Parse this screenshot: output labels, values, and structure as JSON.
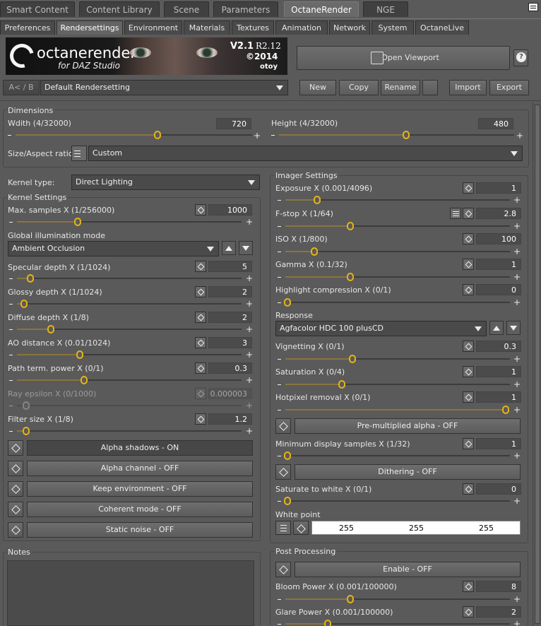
{
  "top_tabs": [
    "Smart Content",
    "Content Library",
    "Scene",
    "Parameters",
    "OctaneRender",
    "NGE"
  ],
  "sub_tabs": [
    "Preferences",
    "Rendersettings",
    "Environment",
    "Materials",
    "Textures",
    "Animation",
    "Network",
    "System",
    "OctaneLive"
  ],
  "logo": {
    "brand": "octanerender",
    "tagline": "for DAZ Studio",
    "version": "V2.1",
    "release": "R2.12",
    "year": "©2014",
    "company": "otoy"
  },
  "toolbar": {
    "ab": "A< / B",
    "preset": "Default Rendersetting",
    "open_viewport": "Open Viewport",
    "help": "?",
    "new": "New",
    "copy": "Copy",
    "rename": "Rename",
    "import": "Import",
    "export": "Export"
  },
  "dimensions": {
    "title": "Dimensions",
    "width_label": "Wdith (4/32000)",
    "width_value": "720",
    "width_pos": 0.6,
    "height_label": "Height (4/32000)",
    "height_value": "480",
    "height_pos": 0.54,
    "aspect_label": "Size/Aspect ratio:",
    "aspect_value": "Custom"
  },
  "kernel": {
    "type_label": "Kernel type:",
    "type_value": "Direct Lighting",
    "settings_title": "Kernel Settings",
    "max_samples": {
      "label": "Max. samples X (1/256000)",
      "value": "1000",
      "pos": 0.27
    },
    "gi_label": "Global illumination mode",
    "gi_value": "Ambient Occlusion",
    "specular": {
      "label": "Specular depth X (1/1024)",
      "value": "5",
      "pos": 0.09
    },
    "glossy": {
      "label": "Glossy depth X (1/1024)",
      "value": "2",
      "pos": 0.06
    },
    "diffuse": {
      "label": "Diffuse depth X (1/8)",
      "value": "2",
      "pos": 0.18
    },
    "ao": {
      "label": "AO distance X (0.01/1024)",
      "value": "3",
      "pos": 0.3
    },
    "path": {
      "label": "Path term. power X (0/1)",
      "value": "0.3",
      "pos": 0.33
    },
    "ray": {
      "label": "Ray epsilon X (0/1000)",
      "value": "0.000003",
      "pos": 0.06
    },
    "filter": {
      "label": "Filter size X (1/8)",
      "value": "1.2",
      "pos": 0.07
    },
    "alpha_shadows": "Alpha shadows - ON",
    "alpha_channel": "Alpha channel - OFF",
    "keep_env": "Keep environment - OFF",
    "coherent": "Coherent mode - OFF",
    "static_noise": "Static noise - OFF"
  },
  "notes": {
    "title": "Notes"
  },
  "imager": {
    "title": "Imager Settings",
    "exposure": {
      "label": "Exposure X (0.001/4096)",
      "value": "1",
      "pos": 0.17
    },
    "fstop": {
      "label": "F-stop X (1/64)",
      "value": "2.8",
      "pos": 0.3
    },
    "iso": {
      "label": "ISO X (1/800)",
      "value": "100",
      "pos": 0.12
    },
    "gamma": {
      "label": "Gamma X (0.1/32)",
      "value": "1",
      "pos": 0.3
    },
    "highlight": {
      "label": "Highlight compression X (0/1)",
      "value": "0",
      "pos": 0.0
    },
    "response_label": "Response",
    "response_value": "Agfacolor HDC 100 plusCD",
    "vignetting": {
      "label": "Vignetting X (0/1)",
      "value": "0.3",
      "pos": 0.3
    },
    "saturation": {
      "label": "Saturation X (0/4)",
      "value": "1",
      "pos": 0.25
    },
    "hotpixel": {
      "label": "Hotpixel removal X (0/1)",
      "value": "1",
      "pos": 1.0
    },
    "premult": "Pre-multiplied alpha - OFF",
    "min_samples": {
      "label": "Minimum display samples X (1/32)",
      "value": "1",
      "pos": 0.0
    },
    "dithering": "Dithering - OFF",
    "sat_white": {
      "label": "Saturate to white X (0/1)",
      "value": "0",
      "pos": 0.0
    },
    "white_label": "White point",
    "white_r": "255",
    "white_g": "255",
    "white_b": "255"
  },
  "post": {
    "title": "Post Processing",
    "enable": "Enable - OFF",
    "bloom": {
      "label": "Bloom Power X (0.001/100000)",
      "value": "8",
      "pos": 0.3
    },
    "glare": {
      "label": "Glare Power X (0.001/100000)",
      "value": "2",
      "pos": 0.22
    }
  }
}
